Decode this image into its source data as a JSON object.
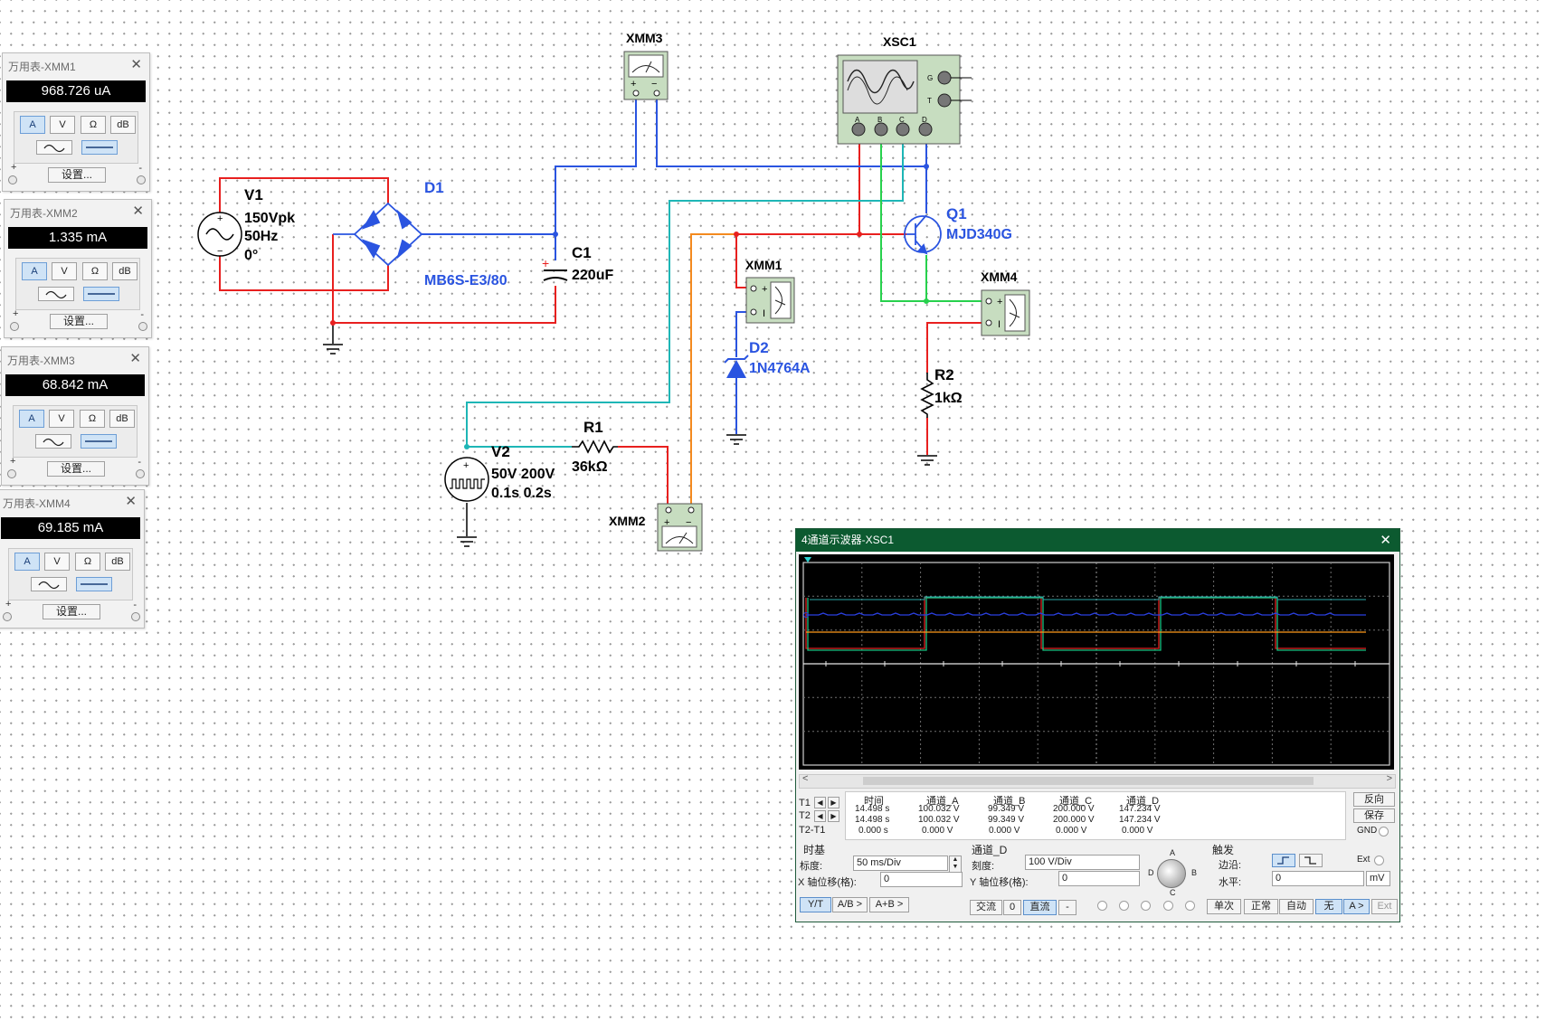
{
  "schematic": {
    "components": {
      "v1": {
        "name": "V1",
        "line1": "150Vpk",
        "line2": "50Hz",
        "line3": "0°"
      },
      "d1": {
        "name": "D1",
        "part": "MB6S-E3/80"
      },
      "c1": {
        "name": "C1",
        "value": "220uF",
        "polarity": "+"
      },
      "xmm3": {
        "name": "XMM3"
      },
      "xsc1": {
        "name": "XSC1",
        "ports": [
          "A",
          "B",
          "C",
          "D"
        ],
        "side_ports": [
          "G",
          "T"
        ]
      },
      "q1": {
        "name": "Q1",
        "part": "MJD340G"
      },
      "xmm1": {
        "name": "XMM1"
      },
      "d2": {
        "name": "D2",
        "part": "1N4764A"
      },
      "xmm4": {
        "name": "XMM4"
      },
      "r2": {
        "name": "R2",
        "value": "1kΩ"
      },
      "r1": {
        "name": "R1",
        "value": "36kΩ"
      },
      "v2": {
        "name": "V2",
        "line1": "50V 200V",
        "line2": "0.1s 0.2s"
      },
      "xmm2": {
        "name": "XMM2"
      }
    }
  },
  "multimeters": [
    {
      "title": "万用表-XMM1",
      "reading": "968.726 uA"
    },
    {
      "title": "万用表-XMM2",
      "reading": "1.335 mA"
    },
    {
      "title": "万用表-XMM3",
      "reading": "68.842 mA"
    },
    {
      "title": "万用表-XMM4",
      "reading": "69.185 mA"
    }
  ],
  "mm_common": {
    "btn_a": "A",
    "btn_v": "V",
    "btn_ohm": "Ω",
    "btn_db": "dB",
    "settings": "设置...",
    "plus": "+",
    "minus": "-",
    "close": "✕"
  },
  "scope": {
    "title": "4通道示波器-XSC1",
    "close": "✕",
    "readout": {
      "headers": [
        "时间",
        "通道_A",
        "通道_B",
        "通道_C",
        "通道_D"
      ],
      "rows": [
        {
          "label": "T1",
          "values": [
            "14.498 s",
            "100.032 V",
            "99.349 V",
            "200.000 V",
            "147.234 V"
          ]
        },
        {
          "label": "T2",
          "values": [
            "14.498 s",
            "100.032 V",
            "99.349 V",
            "200.000 V",
            "147.234 V"
          ]
        },
        {
          "label": "T2-T1",
          "values": [
            "0.000 s",
            "0.000 V",
            "0.000 V",
            "0.000 V",
            "0.000 V"
          ]
        }
      ]
    },
    "right_buttons": {
      "reverse": "反向",
      "save": "保存",
      "gnd": "GND"
    },
    "timebase": {
      "section": "时基",
      "scale_label": "标度:",
      "scale_value": "50 ms/Div",
      "xpos_label": "X 轴位移(格):",
      "xpos_value": "0",
      "modes": [
        "Y/T",
        "A/B >",
        "A+B >"
      ]
    },
    "channel": {
      "section": "通道_D",
      "scale_label": "刻度:",
      "scale_value": "100  V/Div",
      "ypos_label": "Y 轴位移(格):",
      "ypos_value": "0",
      "coupling": [
        "交流",
        "0",
        "直流",
        "-"
      ],
      "knob_labels": [
        "A",
        "B",
        "C",
        "D"
      ]
    },
    "trigger": {
      "section": "触发",
      "edge_label": "边沿:",
      "ext_label": "Ext",
      "level_label": "水平:",
      "level_value": "0",
      "level_unit": "mV",
      "modes": [
        "单次",
        "正常",
        "自动",
        "无",
        "A >",
        "Ext"
      ]
    },
    "traces": {
      "a_color": "#e02020",
      "b_color": "#19c080",
      "c_color": "#2a3fe0",
      "d_color": "#ff9a1a"
    }
  }
}
